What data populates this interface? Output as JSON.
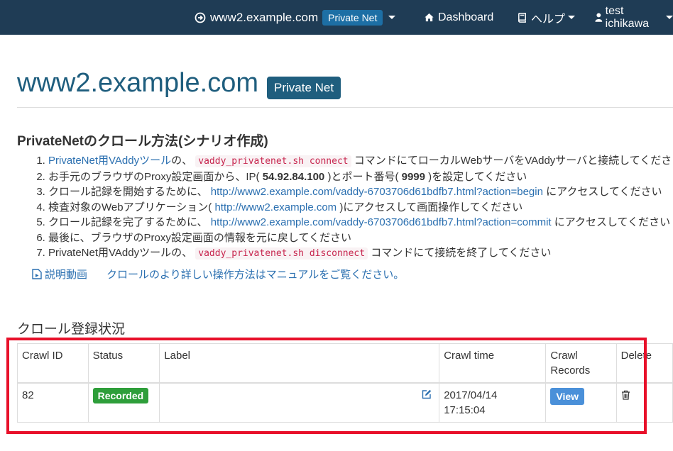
{
  "navbar": {
    "site_name": "www2.example.com",
    "site_badge": "Private Net",
    "dashboard": "Dashboard",
    "help": "ヘルプ",
    "user": "test ichikawa"
  },
  "page": {
    "title": "www2.example.com",
    "title_badge": "Private Net"
  },
  "how_to": {
    "heading": "PrivateNetのクロール方法(シナリオ作成)",
    "steps": [
      {
        "pre": "",
        "link": "PrivateNet用VAddyツール",
        "mid": "の、 ",
        "code": "vaddy_privatenet.sh connect",
        "post": " コマンドにてローカルWebサーバをVAddyサーバと接続してください"
      },
      {
        "pre": "お手元のブラウザのProxy設定画面から、IP( ",
        "bold1": "54.92.84.100",
        "mid": " )とポート番号( ",
        "bold2": "9999",
        "post": " )を設定してください"
      },
      {
        "pre": "クロール記録を開始するために、 ",
        "link": "http://www2.example.com/vaddy-6703706d61bdfb7.html?action=begin",
        "post": " にアクセスしてください"
      },
      {
        "pre": "検査対象のWebアプリケーション( ",
        "link": "http://www2.example.com",
        "post": " )にアクセスして画面操作してください"
      },
      {
        "pre": "クロール記録を完了するために、 ",
        "link": "http://www2.example.com/vaddy-6703706d61bdfb7.html?action=commit",
        "post": " にアクセスしてください"
      },
      {
        "text": "最後に、ブラウザのProxy設定画面の情報を元に戻してください"
      },
      {
        "pre": "PrivateNet用VAddyツールの、 ",
        "code": "vaddy_privatenet.sh disconnect",
        "post": " コマンドにて接続を終了してください"
      }
    ],
    "video_link": "説明動画",
    "manual_link": "クロールのより詳しい操作方法はマニュアルをご覧ください。"
  },
  "crawl_status": {
    "heading": "クロール登録状況",
    "columns": [
      "Crawl ID",
      "Status",
      "Label",
      "Crawl time",
      "Crawl Records",
      "Delete"
    ],
    "rows": [
      {
        "id": "82",
        "status": "Recorded",
        "label": "",
        "time_date": "2017/04/14",
        "time_clock": "17:15:04",
        "records_button": "View"
      }
    ]
  },
  "colors": {
    "navbar_bg": "#1f3c55",
    "title": "#1f5e7e",
    "link": "#2a6fb0",
    "status_green": "#2e9e3a",
    "view_button": "#4a90d9",
    "highlight_border": "#e8102a"
  },
  "icons": {
    "site": "circle-arrow-right-icon",
    "dashboard": "home-icon",
    "help": "book-icon",
    "user": "user-icon",
    "video": "file-video-icon",
    "edit": "edit-icon",
    "delete": "trash-icon"
  }
}
